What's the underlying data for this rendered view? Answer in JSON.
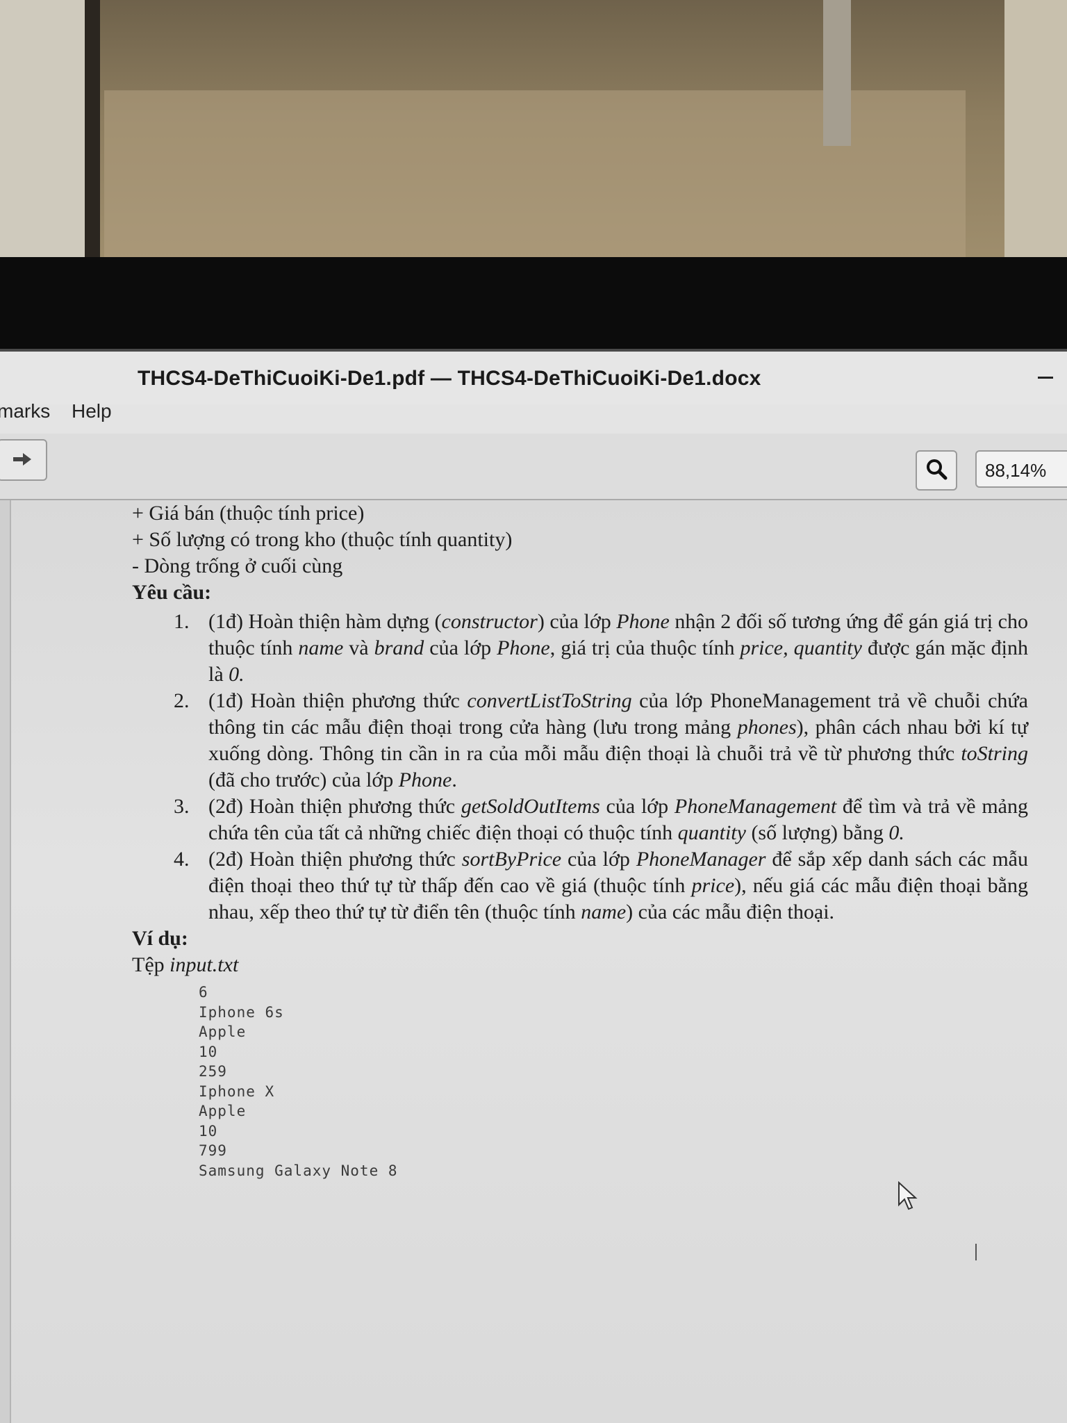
{
  "window": {
    "title": "THCS4-DeThiCuoiKi-De1.pdf — THCS4-DeThiCuoiKi-De1.docx"
  },
  "menu": {
    "items": [
      "marks",
      "Help"
    ]
  },
  "toolbar": {
    "zoom_value": "88,14%"
  },
  "document": {
    "lines_top": [
      "+ Giá bán (thuộc tính price)",
      "+ Số lượng có trong kho (thuộc tính quantity)",
      "- Dòng trống ở cuối cùng"
    ],
    "requirements_heading": "Yêu cầu:",
    "requirements": [
      {
        "number": "1.",
        "parts": [
          "(1đ) Hoàn thiện hàm dựng (",
          "constructor",
          ") của lớp ",
          "Phone",
          " nhận 2 đối số tương ứng để gán giá trị cho thuộc tính ",
          "name",
          " và ",
          "brand",
          " của lớp ",
          "Phone",
          ", giá trị của thuộc tính ",
          "price, quantity",
          " được gán mặc định là ",
          "0."
        ]
      },
      {
        "number": "2.",
        "parts": [
          "(1đ) Hoàn thiện phương thức ",
          "convertListToString",
          " của lớp PhoneManagement trả về chuỗi chứa thông tin các mẫu điện thoại trong cửa hàng (lưu trong mảng ",
          "phones",
          "), phân cách nhau bởi kí tự xuống dòng. Thông tin cần in ra của mỗi mẫu điện thoại là chuỗi trả về từ phương thức ",
          "toString",
          " (đã cho trước) của lớp ",
          "Phone",
          "."
        ]
      },
      {
        "number": "3.",
        "parts": [
          "(2đ) Hoàn thiện phương thức ",
          "getSoldOutItems",
          " của lớp ",
          "PhoneManagement",
          " để tìm và trả về mảng chứa tên của tất cả những chiếc điện thoại có thuộc tính ",
          "quantity",
          " (số lượng) bằng ",
          "0."
        ]
      },
      {
        "number": "4.",
        "parts": [
          "(2đ) Hoàn thiện phương thức ",
          "sortByPrice",
          " của lớp ",
          "PhoneManager",
          " để sắp xếp danh sách các mẫu điện thoại theo thứ tự từ thấp đến cao về giá (thuộc tính ",
          "price",
          "), nếu giá các mẫu điện thoại bằng nhau, xếp theo thứ tự từ điển tên (thuộc tính ",
          "name",
          ") của các mẫu điện thoại."
        ]
      }
    ],
    "example_heading": "Ví dụ:",
    "file_label_prefix": "Tệp ",
    "file_name": "input.txt",
    "code_lines": [
      "6",
      "Iphone 6s",
      "Apple",
      "10",
      "259",
      "Iphone X",
      "Apple",
      "10",
      "799",
      "Samsung Galaxy Note 8"
    ]
  }
}
